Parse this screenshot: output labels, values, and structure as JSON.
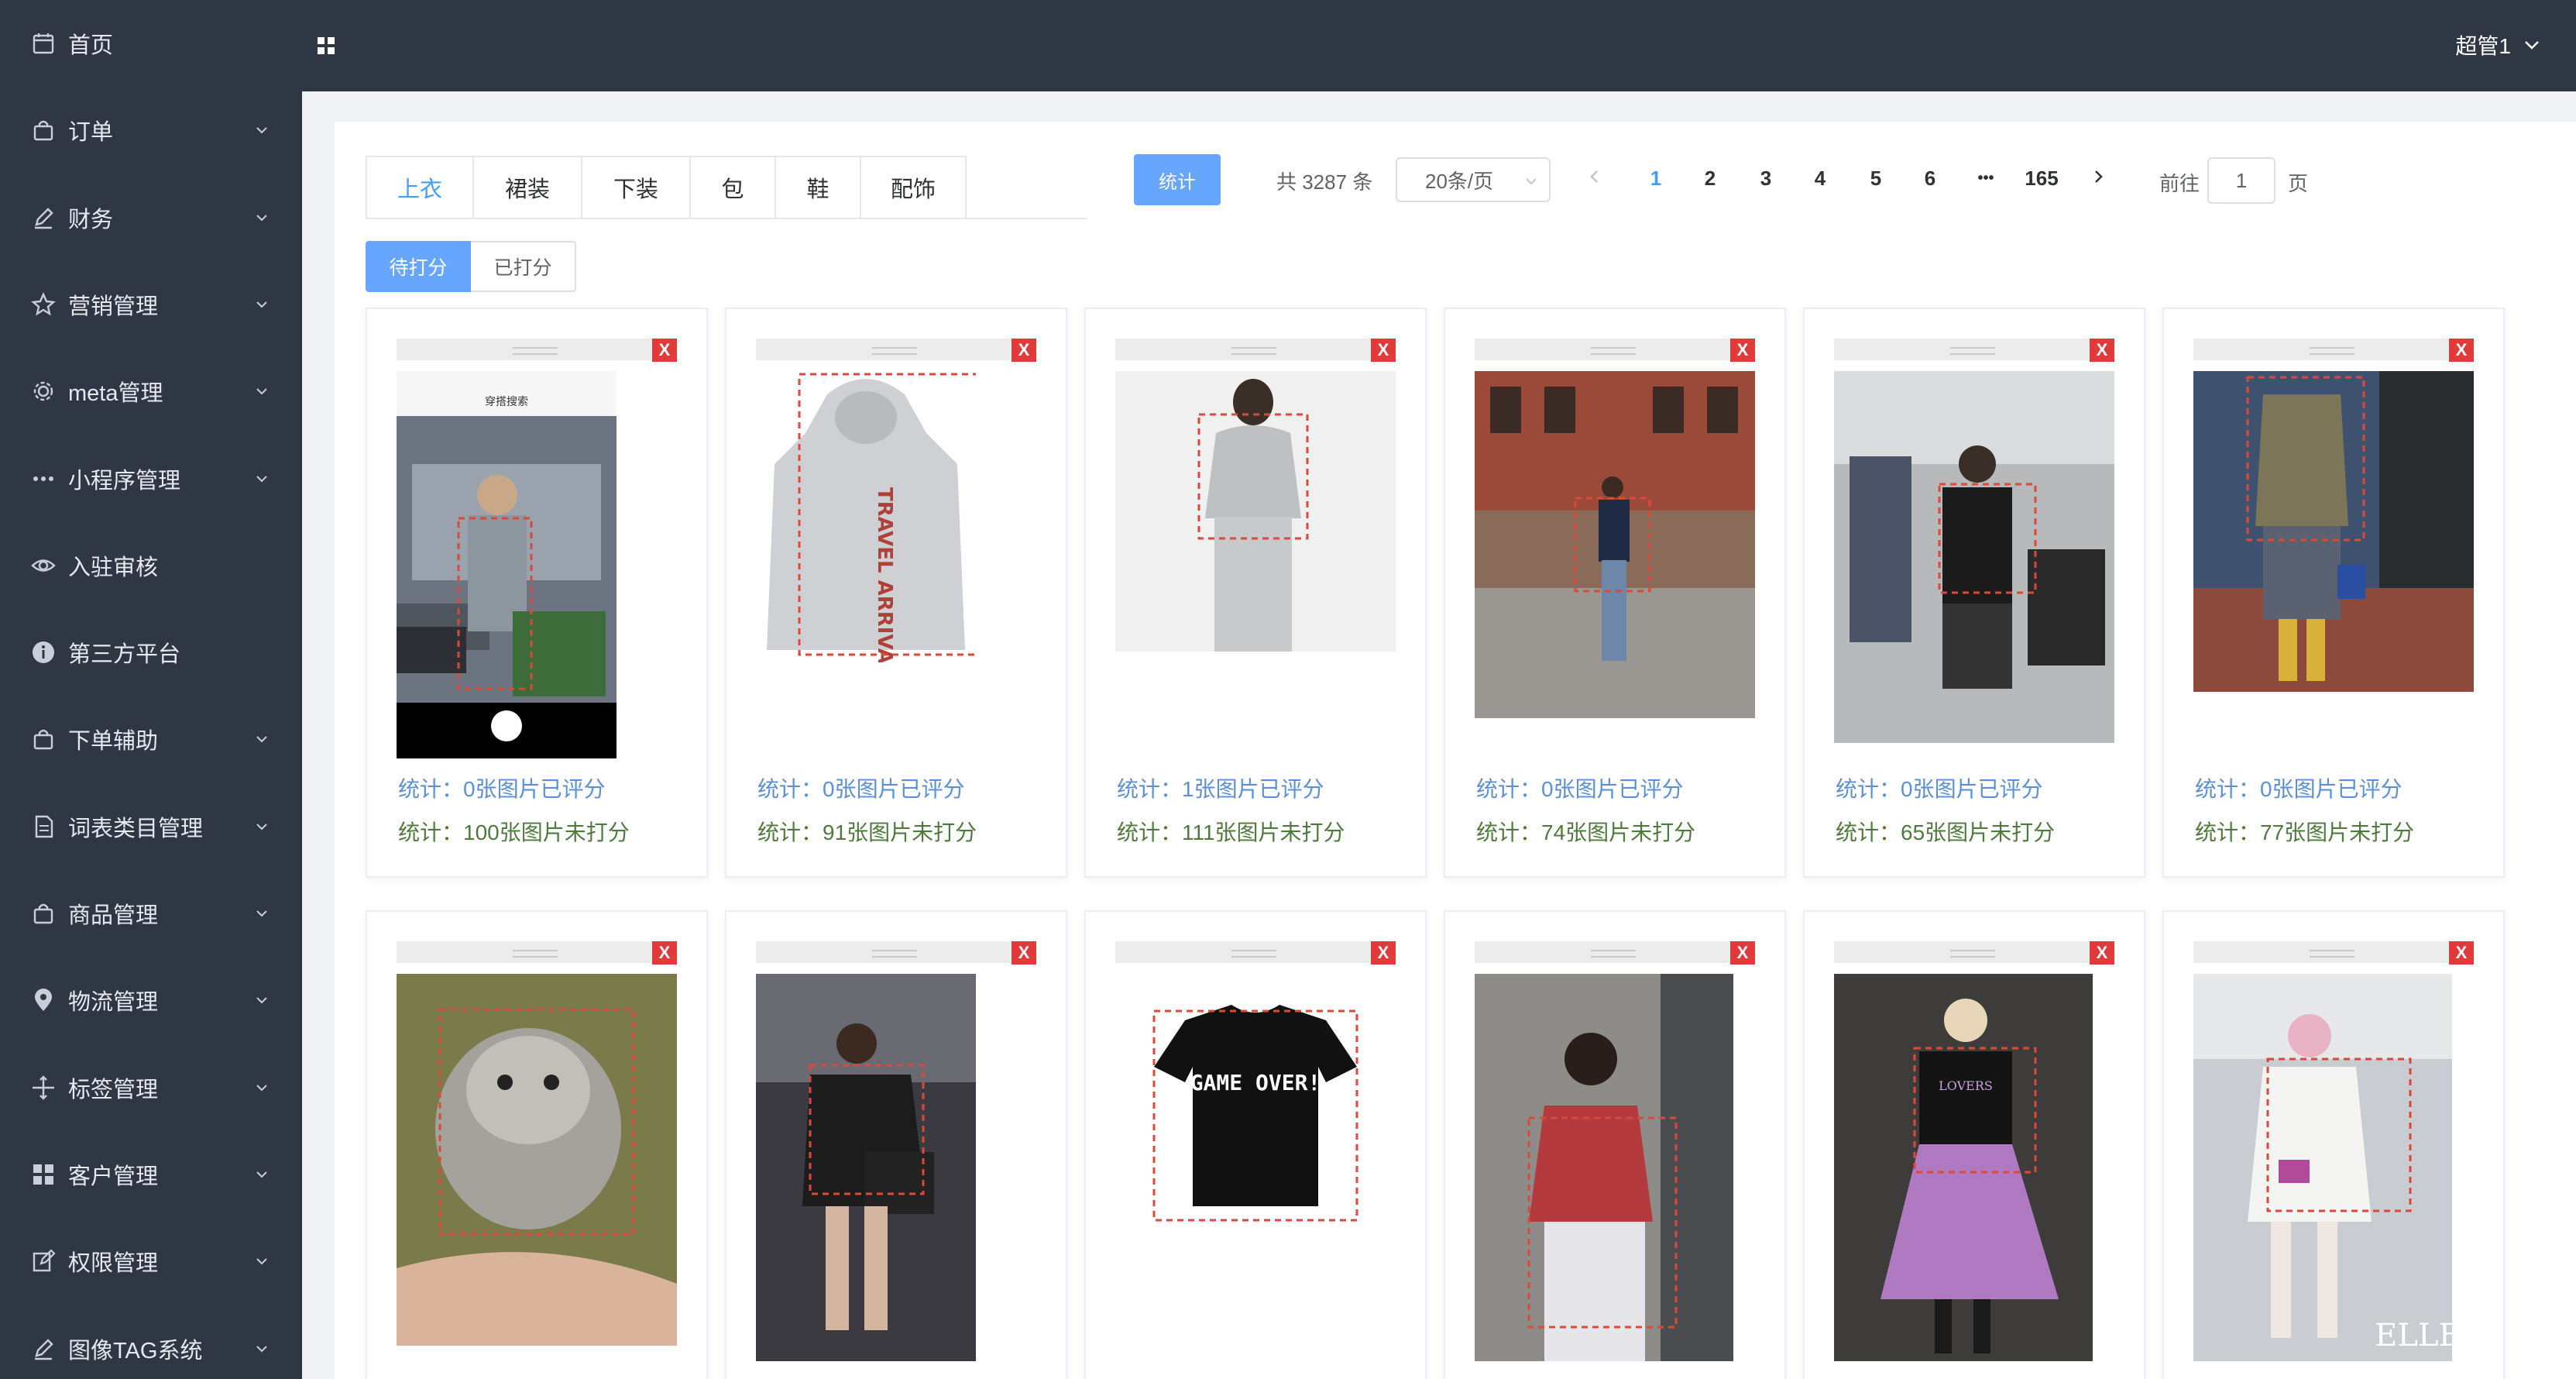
{
  "sidebar": {
    "items": [
      {
        "label": "首页",
        "icon": "calendar-icon",
        "has_children": false
      },
      {
        "label": "订单",
        "icon": "bag-icon",
        "has_children": true
      },
      {
        "label": "财务",
        "icon": "pen-icon",
        "has_children": true
      },
      {
        "label": "营销管理",
        "icon": "star-icon",
        "has_children": true
      },
      {
        "label": "meta管理",
        "icon": "gear-icon",
        "has_children": true
      },
      {
        "label": "小程序管理",
        "icon": "more-dots-icon",
        "has_children": true
      },
      {
        "label": "入驻审核",
        "icon": "eye-icon",
        "has_children": false
      },
      {
        "label": "第三方平台",
        "icon": "info-icon",
        "has_children": false
      },
      {
        "label": "下单辅助",
        "icon": "bag-icon",
        "has_children": true
      },
      {
        "label": "词表类目管理",
        "icon": "document-icon",
        "has_children": true
      },
      {
        "label": "商品管理",
        "icon": "bag-icon",
        "has_children": true
      },
      {
        "label": "物流管理",
        "icon": "location-icon",
        "has_children": true
      },
      {
        "label": "标签管理",
        "icon": "move-icon",
        "has_children": true
      },
      {
        "label": "客户管理",
        "icon": "grid-icon",
        "has_children": true
      },
      {
        "label": "权限管理",
        "icon": "edit-icon",
        "has_children": true
      },
      {
        "label": "图像TAG系统",
        "icon": "pen-icon",
        "has_children": true
      }
    ]
  },
  "header": {
    "menu_icon": "grid-icon",
    "user": "超管1"
  },
  "tabs": [
    "上衣",
    "裙装",
    "下装",
    "包",
    "鞋",
    "配饰"
  ],
  "active_tab": "上衣",
  "stat_button": "统计",
  "pagination": {
    "total_text": "共 3287 条",
    "page_size": "20条/页",
    "pages": [
      "1",
      "2",
      "3",
      "4",
      "5",
      "6",
      "•••",
      "165"
    ],
    "current": "1",
    "goto_prefix": "前往",
    "goto_value": "1",
    "goto_suffix": "页"
  },
  "score_tabs": [
    "待打分",
    "已打分"
  ],
  "active_score_tab": "待打分",
  "close_label": "X",
  "cards": [
    {
      "rated": "统计：0张图片已评分",
      "unrated": "统计：100张图片未打分",
      "image": "phone-camera-screenshot-man"
    },
    {
      "rated": "统计：0张图片已评分",
      "unrated": "统计：91张图片未打分",
      "image": "grey-hoodie"
    },
    {
      "rated": "统计：1张图片已评分",
      "unrated": "统计：111张图片未打分",
      "image": "woman-grey-knit"
    },
    {
      "rated": "统计：0张图片已评分",
      "unrated": "统计：74张图片未打分",
      "image": "street-style-woman"
    },
    {
      "rated": "统计：0张图片已评分",
      "unrated": "统计：65张图片未打分",
      "image": "group-of-people"
    },
    {
      "rated": "统计：0张图片已评分",
      "unrated": "统计：77张图片未打分",
      "image": "blazer-street"
    },
    {
      "image": "kitten"
    },
    {
      "image": "woman-black-sweater"
    },
    {
      "image": "black-tshirt"
    },
    {
      "image": "woman-red-sweater"
    },
    {
      "image": "pink-ruffle-skirt"
    },
    {
      "image": "airport-white-outfit"
    }
  ],
  "image_texts": {
    "phone_title": "穿搭搜索",
    "tshirt_print": "GAME OVER!",
    "lovers": "LOVERS",
    "elle": "ELLE",
    "hoodie_print": "TRAVEL ARRIVAL"
  }
}
